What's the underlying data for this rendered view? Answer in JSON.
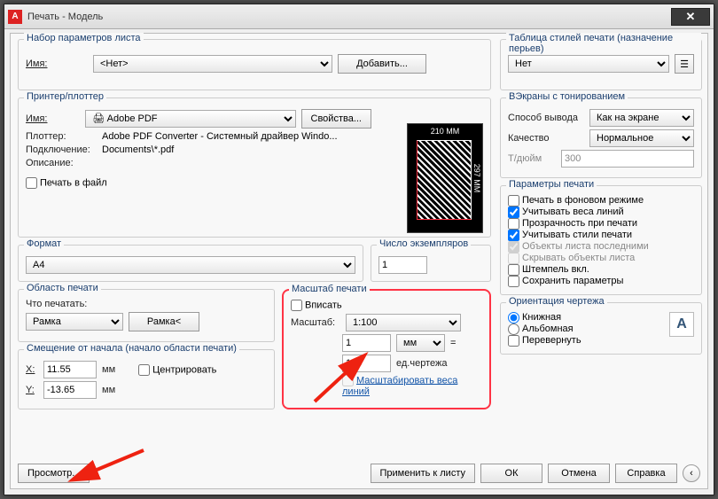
{
  "title": "Печать - Модель",
  "pageSetup": {
    "legend": "Набор параметров листа",
    "nameLbl": "Имя:",
    "name": "<Нет>",
    "addBtn": "Добавить..."
  },
  "printer": {
    "legend": "Принтер/плоттер",
    "nameLbl": "Имя:",
    "name": "Adobe PDF",
    "propsBtn": "Свойства...",
    "plotterLbl": "Плоттер:",
    "plotter": "Adobe PDF Converter - Системный драйвер Windo...",
    "connLbl": "Подключение:",
    "conn": "Documents\\*.pdf",
    "descLbl": "Описание:",
    "toFile": "Печать в файл",
    "previewW": "210 MM",
    "previewH": "297 MM"
  },
  "paper": {
    "legend": "Формат",
    "value": "A4"
  },
  "copies": {
    "legend": "Число экземпляров",
    "value": "1"
  },
  "area": {
    "legend": "Область печати",
    "whatLbl": "Что печатать:",
    "what": "Рамка",
    "windowBtn": "Рамка<"
  },
  "offset": {
    "legend": "Смещение от начала (начало области печати)",
    "x": "11.55",
    "y": "-13.65",
    "unit": "мм",
    "center": "Центрировать",
    "xl": "X:",
    "yl": "Y:"
  },
  "scale": {
    "legend": "Масштаб печати",
    "fit": "Вписать",
    "scaleLbl": "Масштаб:",
    "ratio": "1:100",
    "paper": "1",
    "paperUnit": "мм",
    "eq": "=",
    "drawing": "100",
    "drawingUnit": "ед.чертежа",
    "scaleLW": "Масштабировать веса линий"
  },
  "styles": {
    "legend": "Таблица стилей печати (назначение перьев)",
    "value": "Нет"
  },
  "shaded": {
    "legend": "ВЭкраны с тонированием",
    "modeLbl": "Способ вывода",
    "mode": "Как на экране",
    "qualLbl": "Качество",
    "qual": "Нормальное",
    "dpiLbl": "Т/дюйм",
    "dpi": "300"
  },
  "options": {
    "legend": "Параметры печати",
    "bg": "Печать в фоновом режиме",
    "lw": "Учитывать веса линий",
    "tr": "Прозрачность при печати",
    "ps": "Учитывать стили печати",
    "pl": "Объекты листа последними",
    "ho": "Скрывать объекты листа",
    "st": "Штемпель вкл.",
    "sv": "Сохранить параметры"
  },
  "orient": {
    "legend": "Ориентация чертежа",
    "port": "Книжная",
    "land": "Альбомная",
    "upside": "Перевернуть"
  },
  "footer": {
    "preview": "Просмотр...",
    "apply": "Применить к листу",
    "ok": "ОК",
    "cancel": "Отмена",
    "help": "Справка"
  }
}
